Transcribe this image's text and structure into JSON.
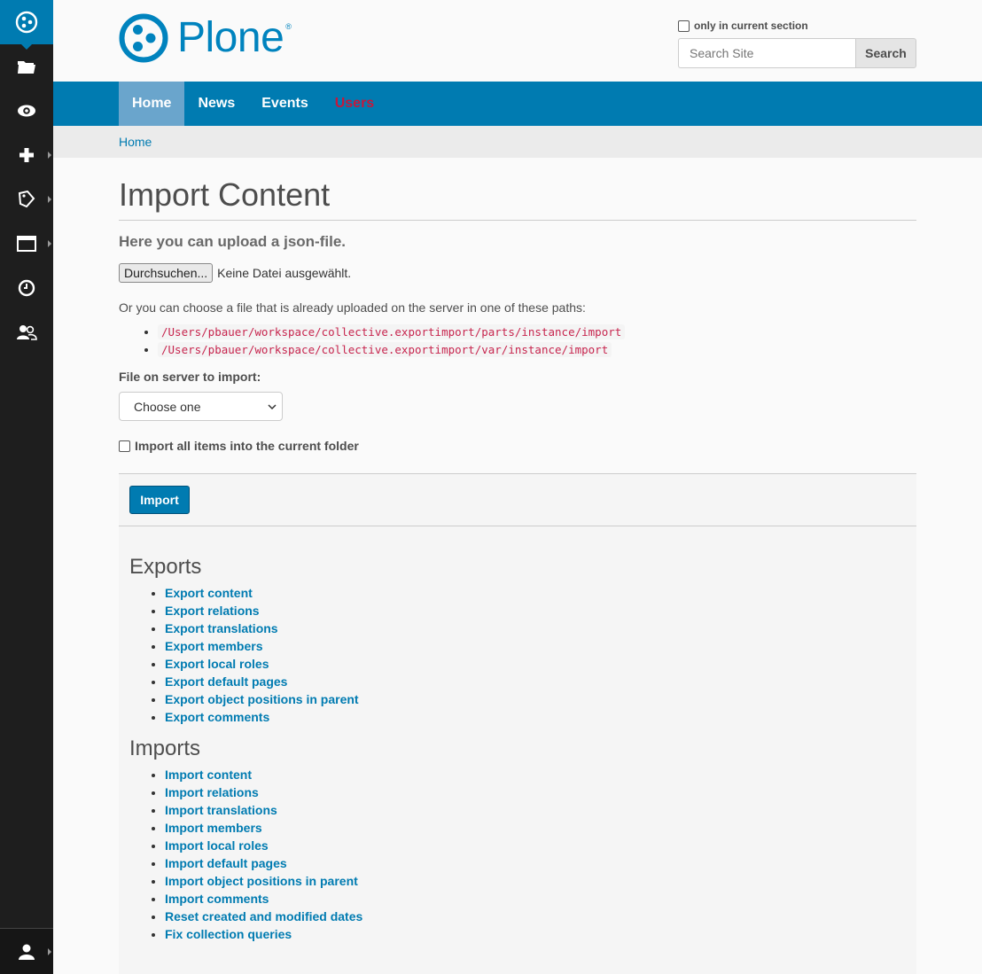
{
  "toolbar": {
    "items": [
      {
        "name": "folder-icon",
        "has_submenu": false
      },
      {
        "name": "eye-icon",
        "has_submenu": false
      },
      {
        "name": "plus-icon",
        "has_submenu": true
      },
      {
        "name": "tag-icon",
        "has_submenu": true
      },
      {
        "name": "window-icon",
        "has_submenu": true
      },
      {
        "name": "clock-icon",
        "has_submenu": false
      },
      {
        "name": "users-icon",
        "has_submenu": false
      }
    ],
    "user_icon": "user-icon"
  },
  "header": {
    "logo_text": "Plone",
    "logo_reg": "®",
    "search": {
      "only_section_label": "only in current section",
      "placeholder": "Search Site",
      "button_label": "Search"
    }
  },
  "nav": {
    "items": [
      {
        "label": "Home",
        "active": true
      },
      {
        "label": "News",
        "active": false
      },
      {
        "label": "Events",
        "active": false
      },
      {
        "label": "Users",
        "active": false
      }
    ]
  },
  "breadcrumbs": {
    "home": "Home"
  },
  "main": {
    "title": "Import Content",
    "lead": "Here you can upload a json-file.",
    "file_button": "Durchsuchen...",
    "file_status": "Keine Datei ausgewählt.",
    "or_text": "Or you can choose a file that is already uploaded on the server in one of these paths:",
    "paths": [
      "/Users/pbauer/workspace/collective.exportimport/parts/instance/import",
      "/Users/pbauer/workspace/collective.exportimport/var/instance/import"
    ],
    "file_label": "File on server to import:",
    "select_value": "Choose one",
    "checkbox_label": "Import all items into the current folder",
    "import_button": "Import"
  },
  "exports": {
    "heading": "Exports",
    "links": [
      "Export content",
      "Export relations",
      "Export translations",
      "Export members",
      "Export local roles",
      "Export default pages",
      "Export object positions in parent",
      "Export comments"
    ]
  },
  "imports": {
    "heading": "Imports",
    "links": [
      "Import content",
      "Import relations",
      "Import translations",
      "Import members",
      "Import local roles",
      "Import default pages",
      "Import object positions in parent",
      "Import comments",
      "Reset created and modified dates",
      "Fix collection queries"
    ]
  },
  "colors": {
    "brand_blue": "#007bb1",
    "toolbar_bg": "#1e1e1e",
    "users_link_red": "#c4183c",
    "code_red": "#c7254e"
  }
}
